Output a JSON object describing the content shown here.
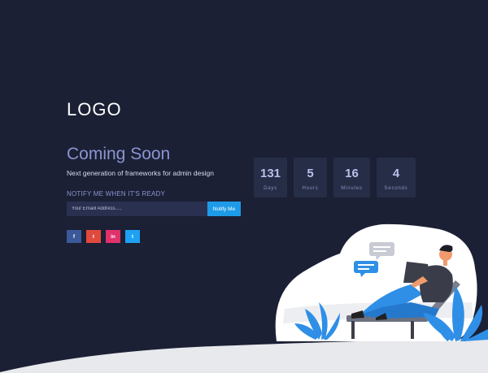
{
  "brand": {
    "logo": "LOGO"
  },
  "hero": {
    "title": "Coming Soon",
    "subtitle": "Next generation of frameworks for admin design",
    "notify_label": "NOTIFY ME WHEN IT'S READY"
  },
  "form": {
    "email_placeholder": "Your Emaill Address.....",
    "email_value": "",
    "button_label": "Notify Me"
  },
  "social": [
    {
      "name": "facebook",
      "glyph": "f",
      "color": "#3b5998"
    },
    {
      "name": "twitter",
      "glyph": "t",
      "color": "#e04a3c"
    },
    {
      "name": "linkedin",
      "glyph": "in",
      "color": "#e0316b"
    },
    {
      "name": "twitter",
      "glyph": "t",
      "color": "#1ea1f2"
    }
  ],
  "countdown": [
    {
      "value": "131",
      "label": "Days"
    },
    {
      "value": "5",
      "label": "Hours"
    },
    {
      "value": "16",
      "label": "Minutes"
    },
    {
      "value": "4",
      "label": "Seconds"
    }
  ],
  "colors": {
    "background": "#1b2035",
    "accent": "#1e9be8",
    "title": "#8b95d0",
    "card": "#262d47"
  }
}
